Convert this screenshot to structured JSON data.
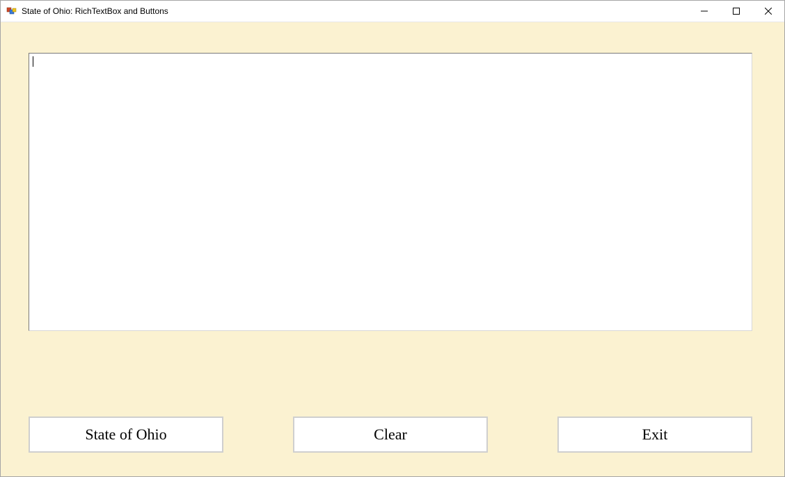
{
  "window": {
    "title": "State of Ohio: RichTextBox and Buttons"
  },
  "richtextbox": {
    "value": ""
  },
  "buttons": {
    "state_label": "State of Ohio",
    "clear_label": "Clear",
    "exit_label": "Exit"
  }
}
